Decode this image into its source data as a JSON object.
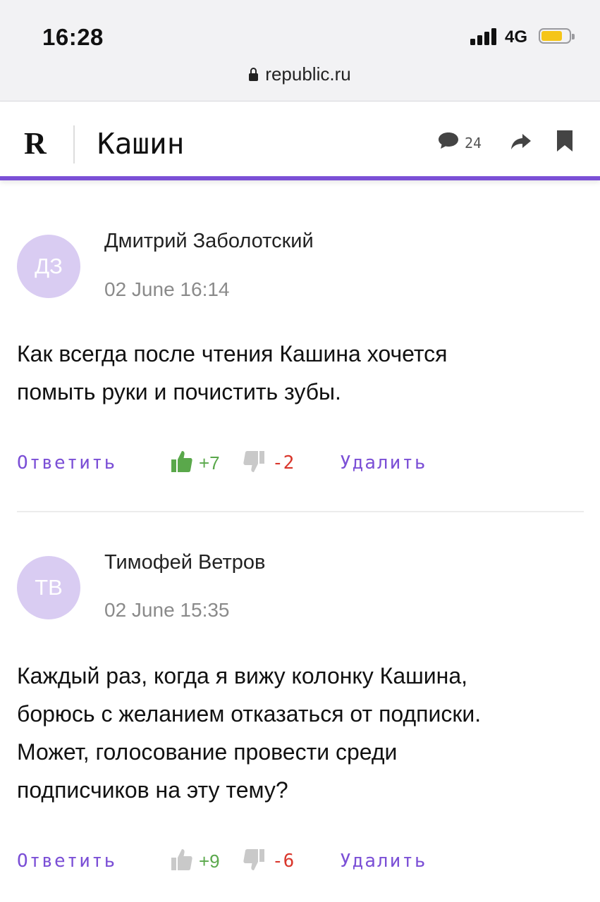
{
  "status_bar": {
    "time": "16:28",
    "network": "4G",
    "battery_level": 0.7
  },
  "browser": {
    "url": "republic.ru"
  },
  "header": {
    "logo": "R",
    "section_title": "Кашин",
    "comments_count": "24",
    "accent_color": "#7b4fd6"
  },
  "comments": [
    {
      "initials": "ДЗ",
      "author": "Дмитрий Заболотский",
      "date": "02 June 16:14",
      "text_lines": [
        "Как всегда после чтения Кашина хочется",
        "помыть руки и почистить зубы."
      ],
      "reply_label": "Ответить",
      "likes": "+7",
      "dislikes": "-2",
      "delete_label": "Удалить",
      "liked": true
    },
    {
      "initials": "ТВ",
      "author": "Тимофей Ветров",
      "date": "02 June 15:35",
      "text_lines": [
        "Каждый раз, когда я вижу колонку Кашина,",
        "борюсь с желанием отказаться от подписки.",
        "Может, голосование провести среди",
        "подписчиков на эту тему?"
      ],
      "reply_label": "Ответить",
      "likes": "+9",
      "dislikes": "-6",
      "delete_label": "Удалить",
      "liked": false
    }
  ]
}
